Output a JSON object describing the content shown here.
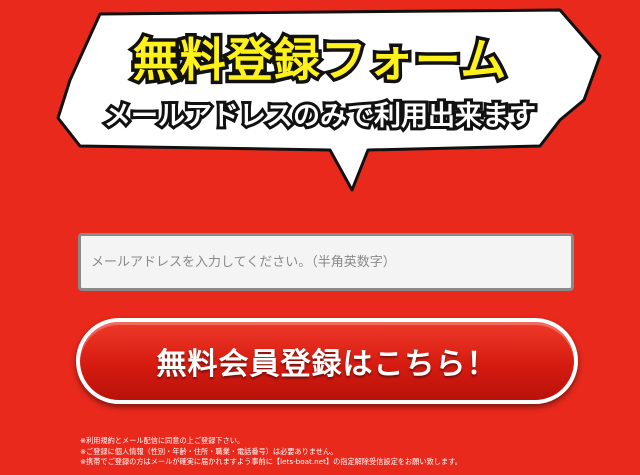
{
  "header": {
    "title": "無料登録フォーム",
    "subtitle": "メールアドレスのみで利用出来ます"
  },
  "form": {
    "email_placeholder": "メールアドレスを入力してください。（半角英数字）",
    "email_value": "",
    "submit_label": "無料会員登録はこちら！"
  },
  "notes": [
    "※利用規約とメール配信に同意の上ご登録下さい。",
    "※ご登録に個人情報（性別・年齢・住所・職業・電話番号）は必要ありません。",
    "※携帯でご登録の方はメールが確実に届かれますよう事前に【lets-boat.net】の指定解除受信設定をお願い致します。"
  ],
  "colors": {
    "background": "#e8291c",
    "title_yellow": "#fff21a",
    "button_red": "#d61b10"
  }
}
